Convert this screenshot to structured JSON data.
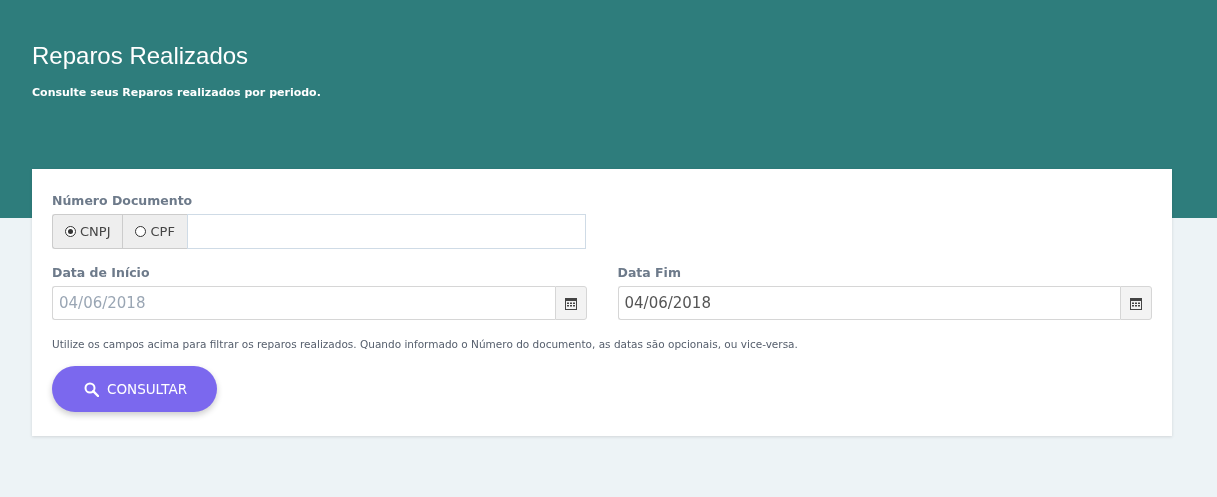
{
  "header": {
    "title": "Reparos Realizados",
    "subtitle": "Consulte seus Reparos realizados por periodo."
  },
  "document": {
    "label": "Número Documento",
    "options": [
      {
        "label": "CNPJ",
        "selected": true
      },
      {
        "label": "CPF",
        "selected": false
      }
    ]
  },
  "start_date": {
    "label": "Data de Início",
    "placeholder": "04/06/2018"
  },
  "end_date": {
    "label": "Data Fim",
    "value": "04/06/2018"
  },
  "help_text": "Utilize os campos acima para filtrar os reparos realizados. Quando informado o Número do documento, as datas são opcionais, ou vice-versa.",
  "search_button": "CONSULTAR"
}
